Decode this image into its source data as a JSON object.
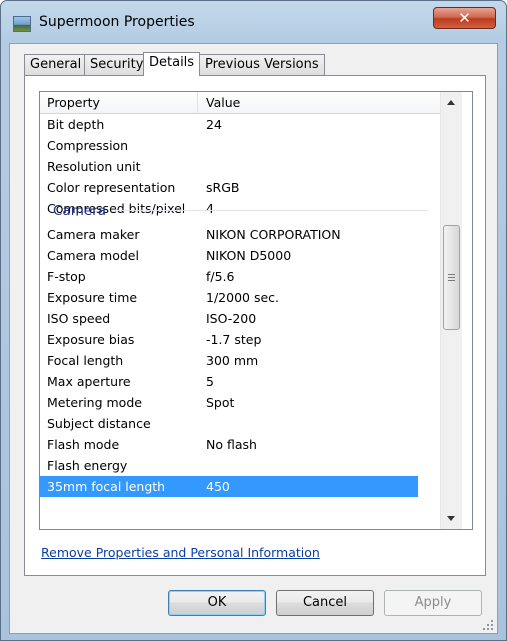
{
  "window": {
    "title": "Supermoon Properties",
    "close_glyph": "✕"
  },
  "tabs": [
    {
      "label": "General"
    },
    {
      "label": "Security"
    },
    {
      "label": "Details",
      "active": true
    },
    {
      "label": "Previous Versions"
    }
  ],
  "list": {
    "header": {
      "property": "Property",
      "value": "Value"
    },
    "rows_top": [
      {
        "property": "Bit depth",
        "value": "24"
      },
      {
        "property": "Compression",
        "value": ""
      },
      {
        "property": "Resolution unit",
        "value": ""
      },
      {
        "property": "Color representation",
        "value": "sRGB"
      },
      {
        "property": "Compressed bits/pixel",
        "value": "4"
      }
    ],
    "group": "Camera",
    "rows_camera": [
      {
        "property": "Camera maker",
        "value": "NIKON CORPORATION"
      },
      {
        "property": "Camera model",
        "value": "NIKON D5000"
      },
      {
        "property": "F-stop",
        "value": "f/5.6"
      },
      {
        "property": "Exposure time",
        "value": "1/2000 sec."
      },
      {
        "property": "ISO speed",
        "value": "ISO-200"
      },
      {
        "property": "Exposure bias",
        "value": "-1.7 step"
      },
      {
        "property": "Focal length",
        "value": "300 mm"
      },
      {
        "property": "Max aperture",
        "value": "5"
      },
      {
        "property": "Metering mode",
        "value": "Spot"
      },
      {
        "property": "Subject distance",
        "value": ""
      },
      {
        "property": "Flash mode",
        "value": "No flash"
      },
      {
        "property": "Flash energy",
        "value": ""
      },
      {
        "property": "35mm focal length",
        "value": "450",
        "selected": true
      }
    ]
  },
  "link": "Remove Properties and Personal Information",
  "buttons": {
    "ok": "OK",
    "cancel": "Cancel",
    "apply": "Apply"
  },
  "colors": {
    "selection": "#3399ff",
    "group_label": "#1e3287",
    "link": "#0a3ea3"
  }
}
